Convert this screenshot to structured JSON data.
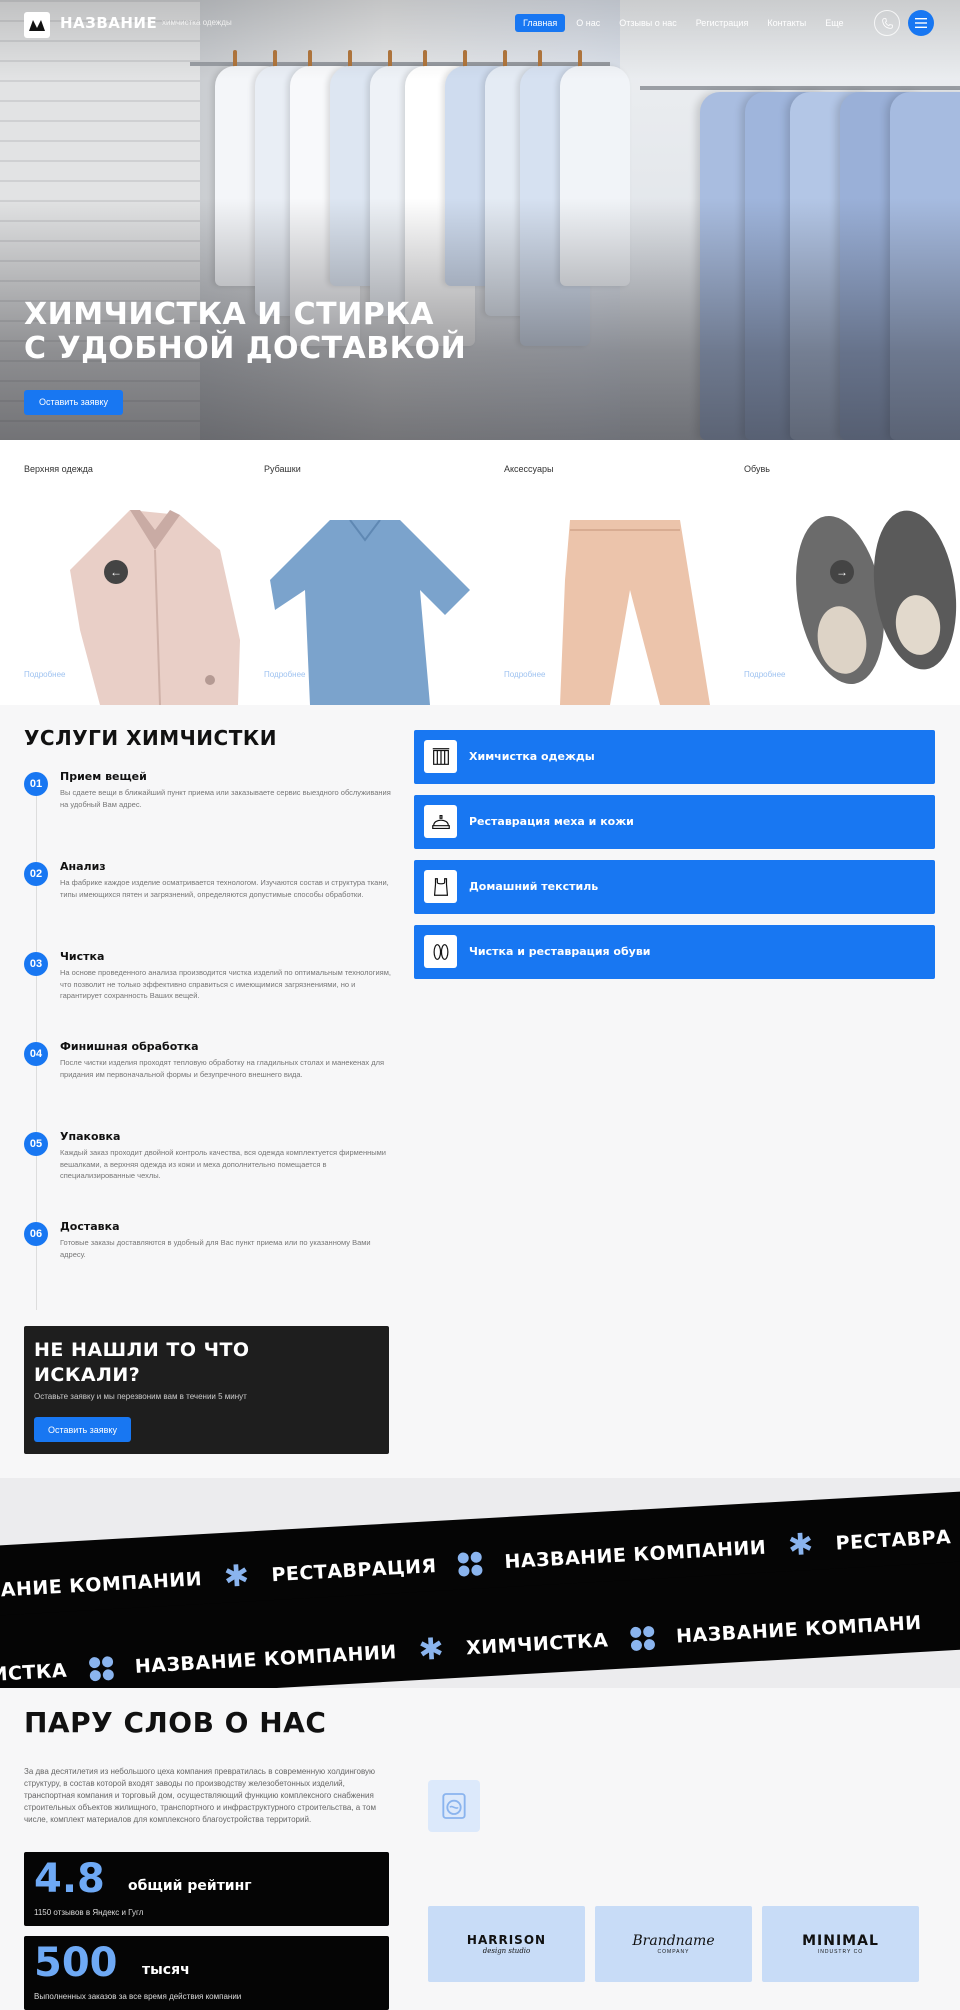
{
  "header": {
    "brand": "НАЗВАНИЕ",
    "brand_sub": "химчистка одежды",
    "nav": [
      "Главная",
      "О нас",
      "Отзывы о нас",
      "Регистрация",
      "Контакты",
      "Еще"
    ]
  },
  "hero": {
    "title_line1": "ХИМЧИСТКА И СТИРКА",
    "title_line2": "С УДОБНОЙ ДОСТАВКОЙ",
    "cta": "Оставить заявку"
  },
  "categories": {
    "items": [
      {
        "label": "Верхняя одежда",
        "more": "Подробнее"
      },
      {
        "label": "Рубашки",
        "more": "Подробнее"
      },
      {
        "label": "Аксессуары",
        "more": "Подробнее"
      },
      {
        "label": "Обувь",
        "more": "Подробнее"
      }
    ]
  },
  "services": {
    "title": "УСЛУГИ ХИМЧИСТКИ",
    "steps": [
      {
        "num": "01",
        "title": "Прием вещей",
        "text": "Вы сдаете вещи в ближайший пункт приема или заказываете сервис выездного обслуживания на удобный Вам адрес."
      },
      {
        "num": "02",
        "title": "Анализ",
        "text": "На фабрике каждое изделие осматривается технологом. Изучаются состав и структура ткани, типы имеющихся пятен и загрязнений, определяются допустимые способы обработки."
      },
      {
        "num": "03",
        "title": "Чистка",
        "text": "На основе проведенного анализа производится чистка изделий по оптимальным технологиям, что позволит не только эффективно справиться с имеющимися загрязнениями, но и гарантирует сохранность Ваших вещей."
      },
      {
        "num": "04",
        "title": "Финишная обработка",
        "text": "После чистки изделия проходят тепловую обработку на гладильных столах и манекенах для придания им первоначальной формы и безупречного внешнего вида."
      },
      {
        "num": "05",
        "title": "Упаковка",
        "text": "Каждый заказ проходит двойной контроль качества, вся одежда комплектуется фирменными вешалками, а верхняя одежда из кожи и меха дополнительно помещается в специализированные чехлы."
      },
      {
        "num": "06",
        "title": "Доставка",
        "text": "Готовые заказы доставляются в удобный для Вас пункт приема или по указанному Вами адресу."
      }
    ],
    "buttons": [
      {
        "label": "Химчистка одежды",
        "icon": "clothes-icon"
      },
      {
        "label": "Реставрация меха и кожи",
        "icon": "hat-icon"
      },
      {
        "label": "Домашний текстиль",
        "icon": "tank-top-icon"
      },
      {
        "label": "Чистка и реставрация обуви",
        "icon": "slippers-icon"
      }
    ]
  },
  "promo": {
    "title_line1": "НЕ НАШЛИ ТО ЧТО",
    "title_line2": "ИСКАЛИ?",
    "subtitle": "Оставьте заявку и мы перезвоним вам в течении 5 минут",
    "button": "Оставить заявку"
  },
  "ticker": {
    "row1": [
      "АНИЕ КОМПАНИИ",
      "РЕСТАВРАЦИЯ",
      "НАЗВАНИЕ КОМПАНИИ",
      "РЕСТАВРА"
    ],
    "row2": [
      "ИСТКА",
      "НАЗВАНИЕ КОМПАНИИ",
      "ХИМЧИСТКА",
      "НАЗВАНИЕ КОМПАНИ"
    ]
  },
  "about": {
    "title": "ПАРУ СЛОВ О НАС",
    "text": "За два десятилетия из небольшого цеха компания превратилась в современную холдинговую структуру, в состав которой входят заводы по производству железобетонных изделий, транспортная компания и торговый дом, осуществляющий функцию комплексного снабжения строительных объектов жилищного, транспортного и инфраструктурного строительства, а том числе, комплект материалов для комплексного благоустройства территорий.",
    "stats": [
      {
        "value": "4.8",
        "unit": "общий рейтинг",
        "caption": "1150 отзывов в Яндекс и Гугл"
      },
      {
        "value": "500",
        "unit": "тысяч",
        "caption": "Выполненных заказов за все время действия компании"
      }
    ],
    "partners": [
      {
        "name": "HARRISON",
        "sub": "design studio"
      },
      {
        "name": "Brandname",
        "sub": "COMPANY"
      },
      {
        "name": "MINIMAL",
        "sub": "INDUSTRY CO"
      }
    ]
  },
  "colors": {
    "accent": "#1877f2",
    "dark": "#050505",
    "soft_blue": "#8ab4ee"
  }
}
